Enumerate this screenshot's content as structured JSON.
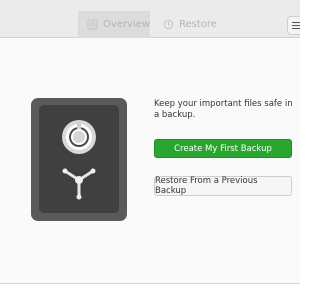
{
  "tabs": {
    "overview": {
      "label": "Overview",
      "icon": "safe-icon"
    },
    "restore": {
      "label": "Restore",
      "icon": "history-icon"
    }
  },
  "menu": {
    "icon": "hamburger-menu-icon"
  },
  "main": {
    "illustration": "safe-illustration",
    "intro_text": "Keep your important files safe in a backup.",
    "create_button_label": "Create My First Backup",
    "restore_button_label": "Restore From a Previous Backup"
  },
  "colors": {
    "primary": "#2aa52f",
    "headerbar": "#ebebeb",
    "safe_body": "#5a5a5a",
    "safe_door": "#404040"
  }
}
